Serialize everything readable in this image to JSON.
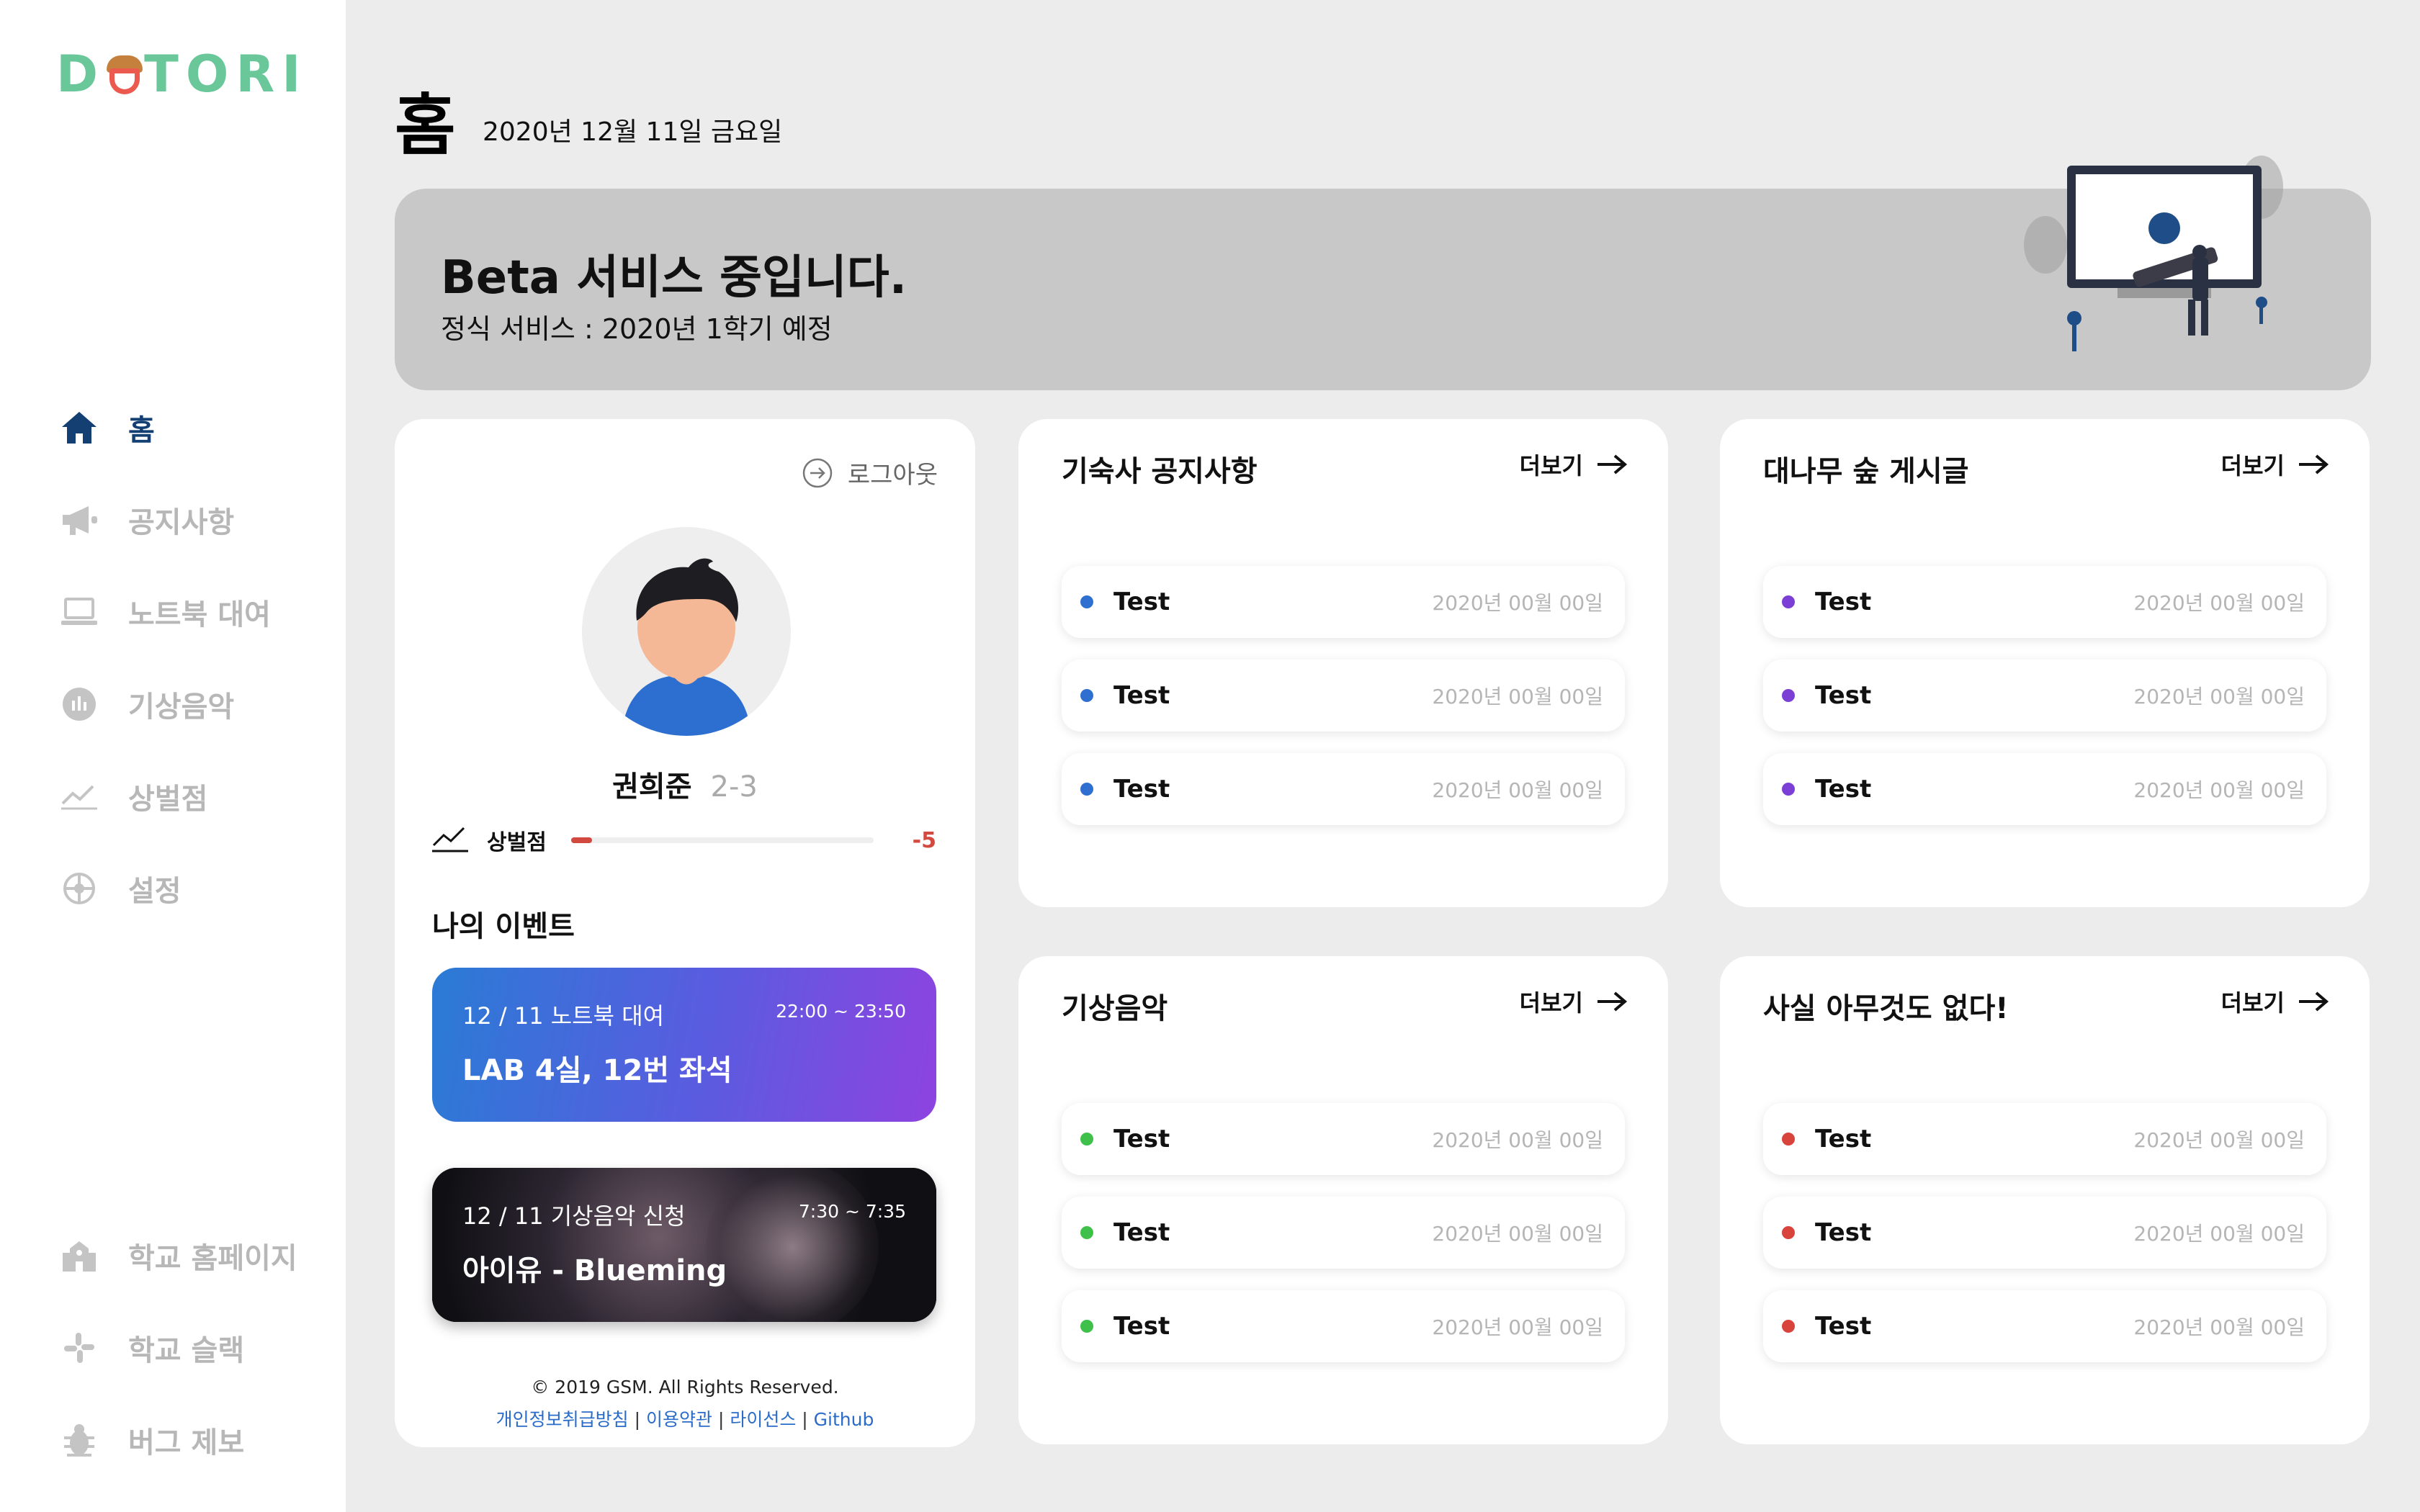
{
  "app": {
    "logo_text": "D O TORI",
    "logo_left": "D",
    "logo_right": "TORI"
  },
  "sidebar": {
    "items": [
      {
        "label": "홈",
        "icon": "home-icon"
      },
      {
        "label": "공지사항",
        "icon": "megaphone-icon"
      },
      {
        "label": "노트북 대여",
        "icon": "laptop-icon"
      },
      {
        "label": "기상음악",
        "icon": "music-icon"
      },
      {
        "label": "상벌점",
        "icon": "chart-line-icon"
      },
      {
        "label": "설정",
        "icon": "gear-icon"
      }
    ],
    "bottom_items": [
      {
        "label": "학교 홈페이지",
        "icon": "school-icon"
      },
      {
        "label": "학교 슬랙",
        "icon": "slack-icon"
      },
      {
        "label": "버그 제보",
        "icon": "bug-icon"
      }
    ],
    "active_color": "#133f73",
    "inactive_color": "#b7b7b7"
  },
  "header": {
    "title": "홈",
    "date": "2020년 12월 11일 금요일"
  },
  "banner": {
    "title": "Beta 서비스 중입니다.",
    "subtitle": "정식 서비스 : 2020년 1학기 예정"
  },
  "profile": {
    "logout_label": "로그아웃",
    "name": "권희준",
    "class": "2-3",
    "points_label": "상벌점",
    "points_value": "-5",
    "points_fraction": 0.07,
    "events_title": "나의 이벤트",
    "events": [
      {
        "date": "12 / 11 노트북 대여",
        "time": "22:00 ~ 23:50",
        "name": "LAB 4실, 12번 좌석"
      },
      {
        "date": "12 / 11 기상음악 신청",
        "time": "7:30 ~ 7:35",
        "name": "아이유 - Blueming"
      }
    ],
    "footer": {
      "copyright": "© 2019 GSM. All Rights Reserved.",
      "links": [
        "개인정보취급방침",
        "이용약관",
        "라이선스",
        "Github"
      ],
      "separator": " | "
    }
  },
  "boards": [
    {
      "title": "기숙사 공지사항",
      "more": "더보기",
      "dot_color": "#2f6fd0",
      "posts": [
        {
          "title": "Test",
          "date": "2020년 00월 00일"
        },
        {
          "title": "Test",
          "date": "2020년 00월 00일"
        },
        {
          "title": "Test",
          "date": "2020년 00월 00일"
        }
      ]
    },
    {
      "title": "대나무 숲 게시글",
      "more": "더보기",
      "dot_color": "#7c3fd6",
      "posts": [
        {
          "title": "Test",
          "date": "2020년 00월 00일"
        },
        {
          "title": "Test",
          "date": "2020년 00월 00일"
        },
        {
          "title": "Test",
          "date": "2020년 00월 00일"
        }
      ]
    },
    {
      "title": "기상음악",
      "more": "더보기",
      "dot_color": "#3fc04a",
      "posts": [
        {
          "title": "Test",
          "date": "2020년 00월 00일"
        },
        {
          "title": "Test",
          "date": "2020년 00월 00일"
        },
        {
          "title": "Test",
          "date": "2020년 00월 00일"
        }
      ]
    },
    {
      "title": "사실 아무것도 없다!",
      "more": "더보기",
      "dot_color": "#d8433b",
      "posts": [
        {
          "title": "Test",
          "date": "2020년 00월 00일"
        },
        {
          "title": "Test",
          "date": "2020년 00월 00일"
        },
        {
          "title": "Test",
          "date": "2020년 00월 00일"
        }
      ]
    }
  ]
}
